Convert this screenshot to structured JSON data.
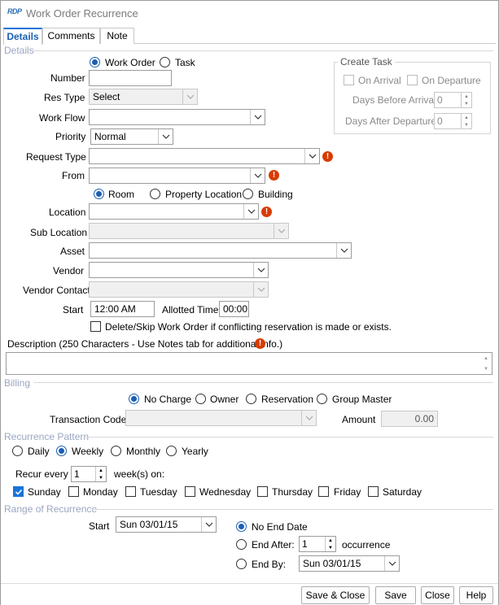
{
  "window": {
    "logo": "RDP",
    "title": "Work Order Recurrence"
  },
  "tabs": [
    {
      "label": "Details"
    },
    {
      "label": "Comments"
    },
    {
      "label": "Note"
    }
  ],
  "sections": {
    "details": "Details",
    "billing": "Billing",
    "recurrence": "Recurrence Pattern",
    "range": "Range of Recurrence"
  },
  "type_radio": {
    "work_order": "Work Order",
    "task": "Task"
  },
  "create_task": {
    "title": "Create Task",
    "on_arrival": "On Arrival",
    "on_departure": "On Departure",
    "days_before_arrival_label": "Days Before Arrival",
    "days_before_arrival_value": "0",
    "days_after_departure_label": "Days After Departure",
    "days_after_departure_value": "0"
  },
  "fields": {
    "number_label": "Number",
    "number_value": "",
    "res_type_label": "Res Type",
    "res_type_value": "Select",
    "work_flow_label": "Work Flow",
    "work_flow_value": "",
    "priority_label": "Priority",
    "priority_value": "Normal",
    "request_type_label": "Request Type",
    "request_type_value": "",
    "from_label": "From",
    "from_value": "",
    "location_label": "Location",
    "location_value": "",
    "sub_location_label": "Sub Location",
    "sub_location_value": "",
    "asset_label": "Asset",
    "asset_value": "",
    "vendor_label": "Vendor",
    "vendor_value": "",
    "vendor_contact_label": "Vendor Contact",
    "vendor_contact_value": "",
    "start_label": "Start",
    "start_value": "12:00 AM",
    "allotted_label": "Allotted Time",
    "allotted_value": "00:00"
  },
  "location_radio": {
    "room": "Room",
    "property": "Property Location",
    "building": "Building"
  },
  "skip_checkbox": "Delete/Skip Work Order if conflicting reservation is made or exists.",
  "description_label": "Description (250 Characters - Use Notes tab for additional info.)",
  "description_value": "",
  "billing": {
    "no_charge": "No Charge",
    "owner": "Owner",
    "reservation": "Reservation",
    "group_master": "Group Master",
    "transaction_code_label": "Transaction Code",
    "transaction_code_value": "",
    "amount_label": "Amount",
    "amount_value": "0.00"
  },
  "recurrence": {
    "daily": "Daily",
    "weekly": "Weekly",
    "monthly": "Monthly",
    "yearly": "Yearly",
    "recur_every_label": "Recur every",
    "recur_every_value": "1",
    "weeks_on_label": "week(s) on:",
    "days": [
      {
        "label": "Sunday",
        "checked": true
      },
      {
        "label": "Monday",
        "checked": false
      },
      {
        "label": "Tuesday",
        "checked": false
      },
      {
        "label": "Wednesday",
        "checked": false
      },
      {
        "label": "Thursday",
        "checked": false
      },
      {
        "label": "Friday",
        "checked": false
      },
      {
        "label": "Saturday",
        "checked": false
      }
    ]
  },
  "range": {
    "start_label": "Start",
    "start_value": "Sun 03/01/15",
    "no_end_date": "No End Date",
    "end_after": "End After:",
    "end_after_value": "1",
    "occurrence_label": "occurrence",
    "end_by": "End By:",
    "end_by_value": "Sun 03/01/15"
  },
  "footer": {
    "save_close": "Save & Close",
    "save": "Save",
    "close": "Close",
    "help": "Help"
  },
  "colors": {
    "accent": "#1a73d9",
    "warning": "#d83b01",
    "section_text": "#9aa6c0"
  }
}
